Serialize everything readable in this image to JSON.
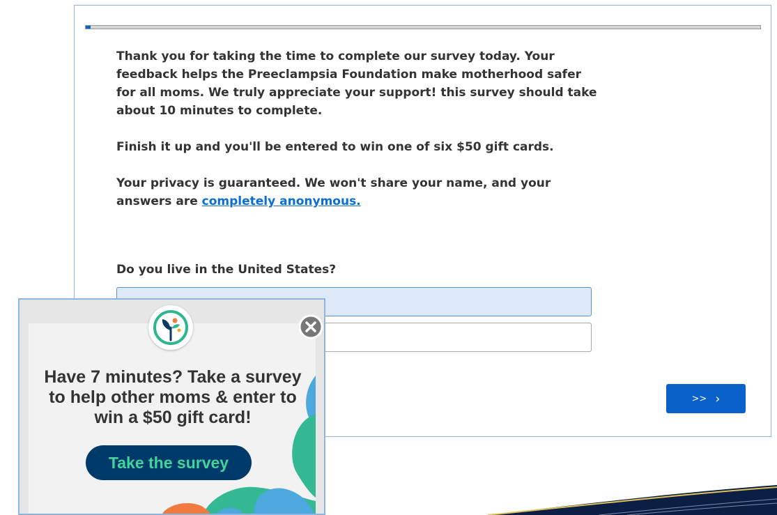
{
  "survey": {
    "progress": {
      "fraction": 0.007
    },
    "intro": {
      "paragraph1": "Thank you for taking the time to complete our survey today. Your feedback helps the Preeclampsia Foundation make motherhood safer for all moms. We truly appreciate your support! this survey should take about 10 minutes to complete.",
      "paragraph2": "Finish it up and you'll be entered to win one of six $50 gift cards.",
      "paragraph3_prefix": "Your privacy is guaranteed. We won't share your name, and your answers are ",
      "paragraph3_link": "completely anonymous."
    },
    "question": "Do you live in the United States?",
    "next_button": {
      "label": ">>",
      "chevron": "›"
    }
  },
  "popup": {
    "logo": "preeclampsia-foundation-logo",
    "close_icon": "close-icon",
    "headline": "Have 7 minutes? Take a survey to help other moms & enter to win a $50 gift card!",
    "cta_label": "Take the survey"
  },
  "colors": {
    "accent_blue": "#0a61c9",
    "link_blue": "#0a6fd1",
    "selected_choice_bg": "#dde9f7",
    "popup_cta_bg": "#003a6b",
    "popup_cta_text": "#43d39b"
  }
}
